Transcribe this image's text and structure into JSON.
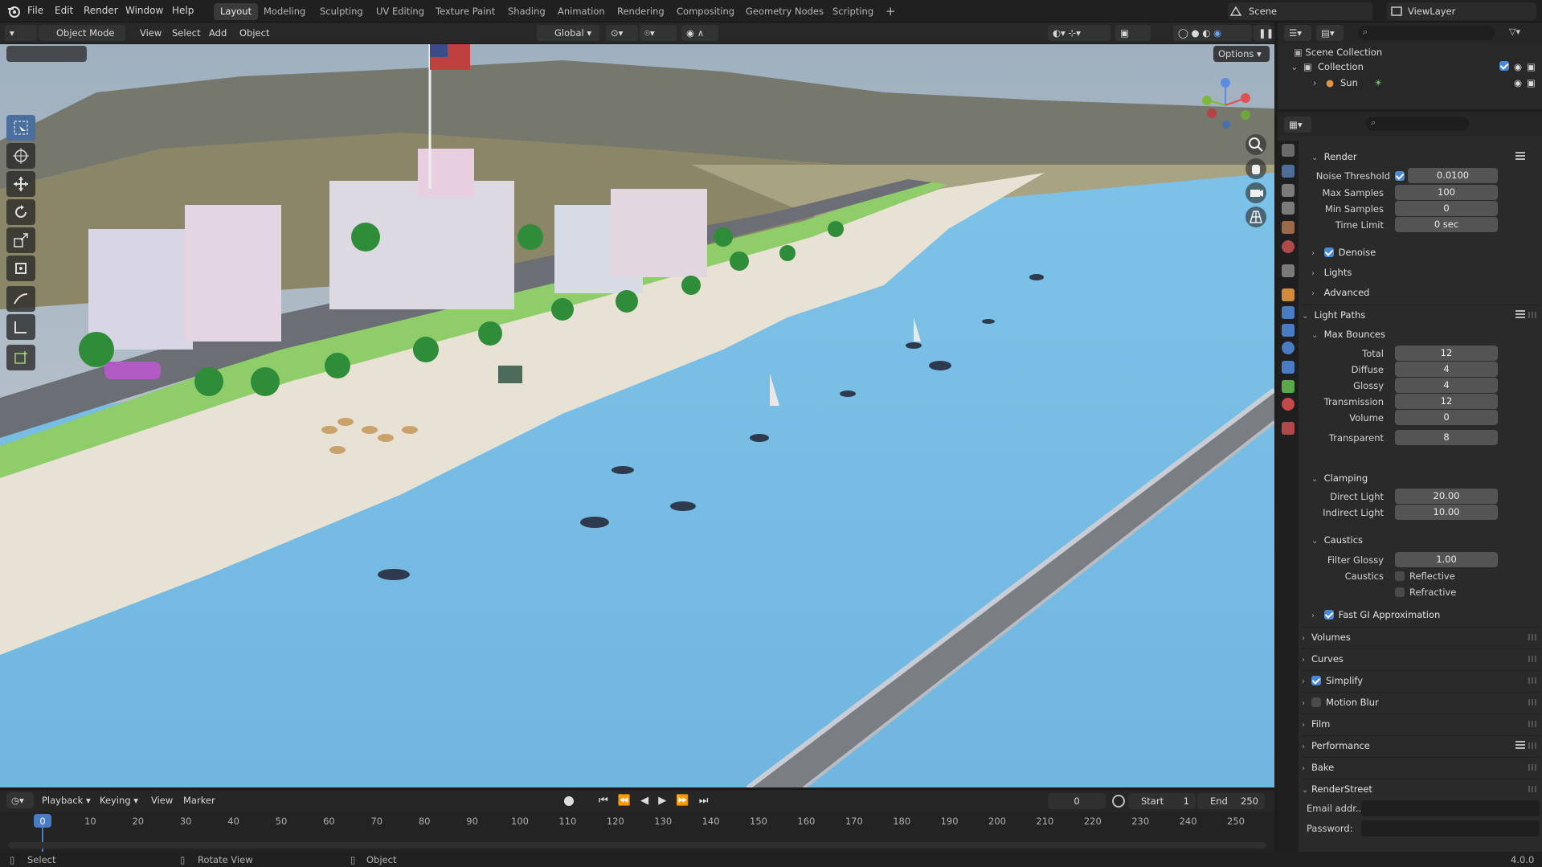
{
  "menus": [
    "File",
    "Edit",
    "Render",
    "Window",
    "Help"
  ],
  "workspaces": [
    "Layout",
    "Modeling",
    "Sculpting",
    "UV Editing",
    "Texture Paint",
    "Shading",
    "Animation",
    "Rendering",
    "Compositing",
    "Geometry Nodes",
    "Scripting"
  ],
  "active_workspace": "Layout",
  "scene": "Scene",
  "view_layer": "ViewLayer",
  "viewport_header": {
    "mode": "Object Mode",
    "menus": [
      "View",
      "Select",
      "Add",
      "Object"
    ],
    "orientation": "Global",
    "options": "Options"
  },
  "outliner": {
    "root": "Scene Collection",
    "collection": "Collection",
    "object": "Sun"
  },
  "properties": {
    "render_header": "Render",
    "noise_threshold_label": "Noise Threshold",
    "noise_threshold": "0.0100",
    "max_samples_label": "Max Samples",
    "max_samples": "100",
    "min_samples_label": "Min Samples",
    "min_samples": "0",
    "time_limit_label": "Time Limit",
    "time_limit": "0 sec",
    "denoise": "Denoise",
    "lights": "Lights",
    "advanced": "Advanced",
    "light_paths": "Light Paths",
    "max_bounces": "Max Bounces",
    "bounces": [
      {
        "label": "Total",
        "value": "12"
      },
      {
        "label": "Diffuse",
        "value": "4"
      },
      {
        "label": "Glossy",
        "value": "4"
      },
      {
        "label": "Transmission",
        "value": "12"
      },
      {
        "label": "Volume",
        "value": "0"
      },
      {
        "label": "Transparent",
        "value": "8"
      }
    ],
    "clamping": "Clamping",
    "direct_light_label": "Direct Light",
    "direct_light": "20.00",
    "indirect_light_label": "Indirect Light",
    "indirect_light": "10.00",
    "caustics_header": "Caustics",
    "filter_glossy_label": "Filter Glossy",
    "filter_glossy": "1.00",
    "caustics_label": "Caustics",
    "reflective": "Reflective",
    "refractive": "Refractive",
    "fast_gi": "Fast GI Approximation",
    "volumes": "Volumes",
    "curves": "Curves",
    "simplify": "Simplify",
    "motion_blur": "Motion Blur",
    "film": "Film",
    "performance": "Performance",
    "bake": "Bake",
    "renderstreet": "RenderStreet",
    "email_label": "Email addr...",
    "password_label": "Password:"
  },
  "timeline": {
    "menus": [
      "Playback",
      "Keying",
      "View",
      "Marker"
    ],
    "current_frame": "0",
    "start_label": "Start",
    "start": "1",
    "end_label": "End",
    "end": "250",
    "ruler": [
      "0",
      "10",
      "20",
      "30",
      "40",
      "50",
      "60",
      "70",
      "80",
      "90",
      "100",
      "110",
      "120",
      "130",
      "140",
      "150",
      "160",
      "170",
      "180",
      "190",
      "200",
      "210",
      "220",
      "230",
      "240",
      "250"
    ]
  },
  "status": {
    "select": "Select",
    "rotate": "Rotate View",
    "object": "Object",
    "version": "4.0.0"
  },
  "colors": {
    "accent": "#4a8ad4",
    "active_tool": "#4a6e9e",
    "water": "#6fb7e2",
    "sand": "#e8e2d4"
  }
}
